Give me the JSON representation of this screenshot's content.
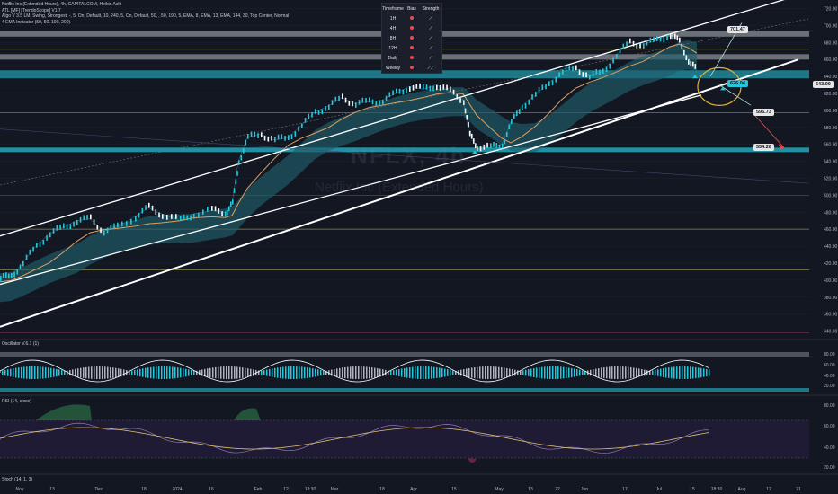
{
  "header": {
    "symbol_line": "Netflix Inc (Extended Hours), 4h, CAPITALCOM, Heikin Ashi",
    "indicator_1": "ATL [MF] [TrendoScope] V1.7",
    "indicator_2": "Algo V 3.5 LM, Swing, Strongest, -, 5, On, Default, 10, 240, 5, On, Default, 50, , 50, 190, 5, EMA, 8, EMA, 13, EMA, 144, 30, Top Center, Normal",
    "indicator_3": "4 EMA Indicator (50, 50, 100, 200)"
  },
  "watermark": {
    "ticker": "NFLX, 4h",
    "name": "Netflix Inc (Extended Hours)"
  },
  "bias_table": {
    "headers": [
      "Timeframe",
      "Bias",
      "Strength"
    ],
    "rows": [
      "1H",
      "4H",
      "8H",
      "12H",
      "Daily",
      "Weekly"
    ]
  },
  "panels": {
    "oscillator_title": "Oscillator V.6.1 (1)",
    "rsi_title": "RSI (14, close)",
    "stoch_title": "Stoch (14, 1, 3)"
  },
  "target_labels": {
    "t1": "701.47",
    "t2": "596.73",
    "t3": "554.26",
    "current": "643.00",
    "mid": "626.04"
  },
  "colors": {
    "bg": "#131722",
    "cyan": "#26c6da",
    "teal_fill": "#1e5d6b",
    "orange": "#e0a060",
    "red": "#e84b4b",
    "white": "#ffffff"
  },
  "chart_data": {
    "type": "line",
    "title": "Netflix Inc (Extended Hours), 4h, CAPITALCOM, Heikin Ashi",
    "x_ticks": [
      "Nov",
      "13",
      "Dec",
      "18",
      "2024",
      "16",
      "Feb",
      "12",
      "18:30",
      "Mar",
      "18",
      "Apr",
      "15",
      "May",
      "13",
      "22",
      "Jun",
      "17",
      "Jul",
      "15",
      "18:30",
      "Aug",
      "12",
      "21"
    ],
    "y_ticks": [
      720,
      700,
      680,
      660,
      640,
      620,
      600,
      580,
      560,
      540,
      520,
      500,
      480,
      460,
      440,
      420,
      400,
      380,
      360,
      340
    ],
    "ylim": [
      330,
      730
    ],
    "price": [
      {
        "x": 0,
        "y": 402
      },
      {
        "x": 12,
        "y": 405
      },
      {
        "x": 25,
        "y": 420
      },
      {
        "x": 40,
        "y": 440
      },
      {
        "x": 55,
        "y": 455
      },
      {
        "x": 70,
        "y": 462
      },
      {
        "x": 85,
        "y": 470
      },
      {
        "x": 100,
        "y": 472
      },
      {
        "x": 115,
        "y": 458
      },
      {
        "x": 130,
        "y": 462
      },
      {
        "x": 150,
        "y": 475
      },
      {
        "x": 165,
        "y": 485
      },
      {
        "x": 180,
        "y": 478
      },
      {
        "x": 200,
        "y": 470
      },
      {
        "x": 215,
        "y": 478
      },
      {
        "x": 235,
        "y": 482
      },
      {
        "x": 250,
        "y": 480
      },
      {
        "x": 258,
        "y": 490
      },
      {
        "x": 265,
        "y": 540
      },
      {
        "x": 275,
        "y": 568
      },
      {
        "x": 290,
        "y": 572
      },
      {
        "x": 305,
        "y": 565
      },
      {
        "x": 320,
        "y": 568
      },
      {
        "x": 335,
        "y": 582
      },
      {
        "x": 350,
        "y": 598
      },
      {
        "x": 365,
        "y": 605
      },
      {
        "x": 380,
        "y": 615
      },
      {
        "x": 395,
        "y": 608
      },
      {
        "x": 410,
        "y": 610
      },
      {
        "x": 425,
        "y": 612
      },
      {
        "x": 440,
        "y": 620
      },
      {
        "x": 455,
        "y": 628
      },
      {
        "x": 470,
        "y": 625
      },
      {
        "x": 485,
        "y": 630
      },
      {
        "x": 500,
        "y": 622
      },
      {
        "x": 515,
        "y": 612
      },
      {
        "x": 522,
        "y": 570
      },
      {
        "x": 530,
        "y": 558
      },
      {
        "x": 545,
        "y": 556
      },
      {
        "x": 558,
        "y": 560
      },
      {
        "x": 568,
        "y": 585
      },
      {
        "x": 580,
        "y": 605
      },
      {
        "x": 595,
        "y": 618
      },
      {
        "x": 610,
        "y": 632
      },
      {
        "x": 625,
        "y": 645
      },
      {
        "x": 640,
        "y": 650
      },
      {
        "x": 655,
        "y": 640
      },
      {
        "x": 670,
        "y": 645
      },
      {
        "x": 685,
        "y": 665
      },
      {
        "x": 700,
        "y": 680
      },
      {
        "x": 715,
        "y": 678
      },
      {
        "x": 730,
        "y": 682
      },
      {
        "x": 745,
        "y": 690
      },
      {
        "x": 755,
        "y": 680
      },
      {
        "x": 765,
        "y": 660
      },
      {
        "x": 775,
        "y": 645
      }
    ],
    "annotations": [
      "701.47",
      "596.73",
      "554.26"
    ],
    "grid": true
  }
}
